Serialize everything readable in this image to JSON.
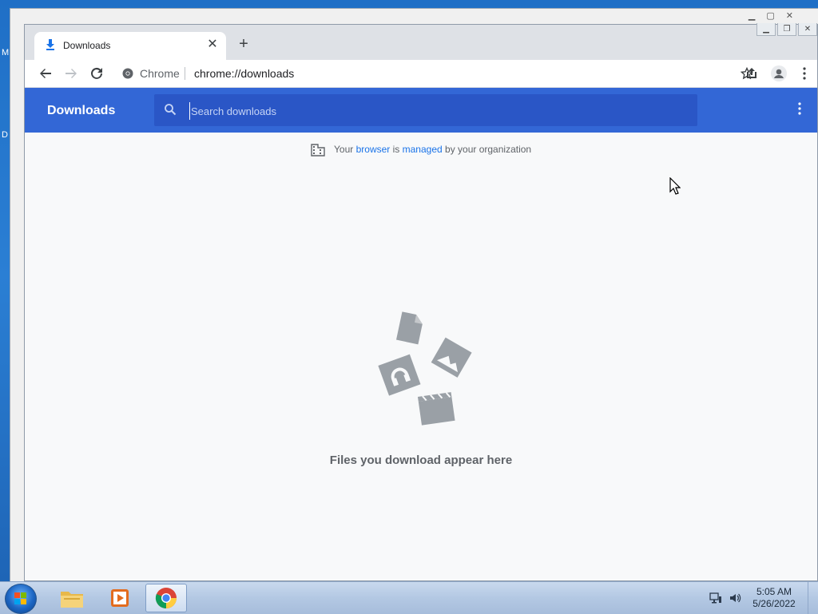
{
  "desktop": {
    "labels": [
      "M",
      "D"
    ]
  },
  "browser": {
    "tab": {
      "title": "Downloads",
      "favicon": "download-icon"
    },
    "site_label": "Chrome",
    "url": "chrome://downloads"
  },
  "downloads": {
    "title": "Downloads",
    "search_placeholder": "Search downloads",
    "managed": {
      "prefix": "Your ",
      "link1": "browser",
      "middle": " is ",
      "link2": "managed",
      "suffix": " by your organization"
    },
    "empty_message": "Files you download appear here"
  },
  "taskbar": {
    "apps": [
      "file-explorer-icon",
      "media-player-icon",
      "chrome-icon"
    ],
    "time": "5:05 AM",
    "date": "5/26/2022"
  },
  "colors": {
    "header_blue": "#3367d6",
    "search_blue": "#2a56c6",
    "link_blue": "#1a73e8"
  }
}
